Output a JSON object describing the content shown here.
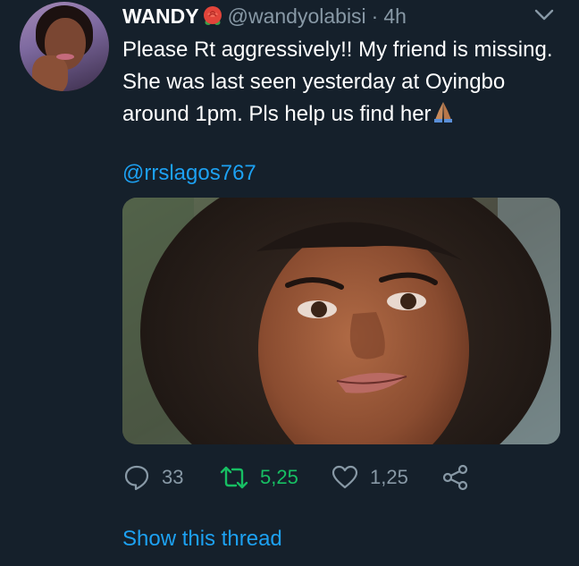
{
  "tweet": {
    "author": {
      "display_name": "WANDY",
      "name_emoji": "rose-icon",
      "handle": "@wandyolabisi",
      "separator": "·",
      "time": "4h",
      "avatar": "avatar"
    },
    "text": "Please Rt aggressively!! My friend is missing. She was last seen yesterday at Oyingbo around 1pm. Pls help us find her",
    "text_trailing_emoji": "pray-icon",
    "mention": "@rrslagos767",
    "media": {
      "kind": "photo",
      "description_icon": "photo-image"
    },
    "actions": {
      "reply": {
        "icon": "reply-icon",
        "count": "33"
      },
      "retweet": {
        "icon": "retweet-icon",
        "count": "5,25"
      },
      "like": {
        "icon": "heart-icon",
        "count": "1,25"
      },
      "share": {
        "icon": "share-icon"
      }
    },
    "show_thread": "Show this thread"
  },
  "colors": {
    "background": "#15202b",
    "text_primary": "#ffffff",
    "text_secondary": "#8899a6",
    "link": "#1da1f2",
    "retweet": "#17bf63"
  }
}
